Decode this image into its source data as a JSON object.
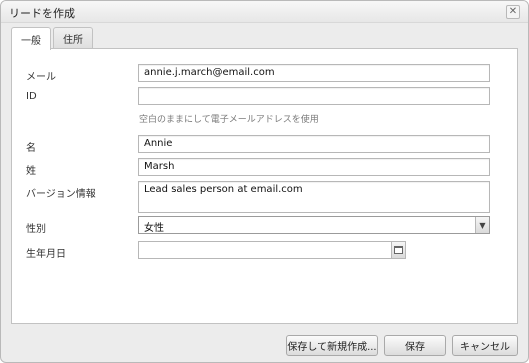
{
  "dialog": {
    "title": "リードを作成",
    "close_glyph": "✕"
  },
  "tabs": [
    {
      "label": "一般",
      "active": true
    },
    {
      "label": "住所",
      "active": false
    }
  ],
  "form": {
    "email": {
      "label": "メール",
      "value": "annie.j.march@email.com"
    },
    "id": {
      "label": "ID",
      "value": "",
      "hint": "空白のままにして電子メールアドレスを使用"
    },
    "first_name": {
      "label": "名",
      "value": "Annie"
    },
    "last_name": {
      "label": "姓",
      "value": "Marsh"
    },
    "bio": {
      "label": "バージョン情報",
      "value": "Lead sales person at email.com"
    },
    "gender": {
      "label": "性別",
      "value": "女性"
    },
    "birthdate": {
      "label": "生年月日",
      "value": ""
    }
  },
  "buttons": {
    "save_and_new": "保存して新規作成...",
    "save": "保存",
    "cancel": "キャンセル"
  }
}
